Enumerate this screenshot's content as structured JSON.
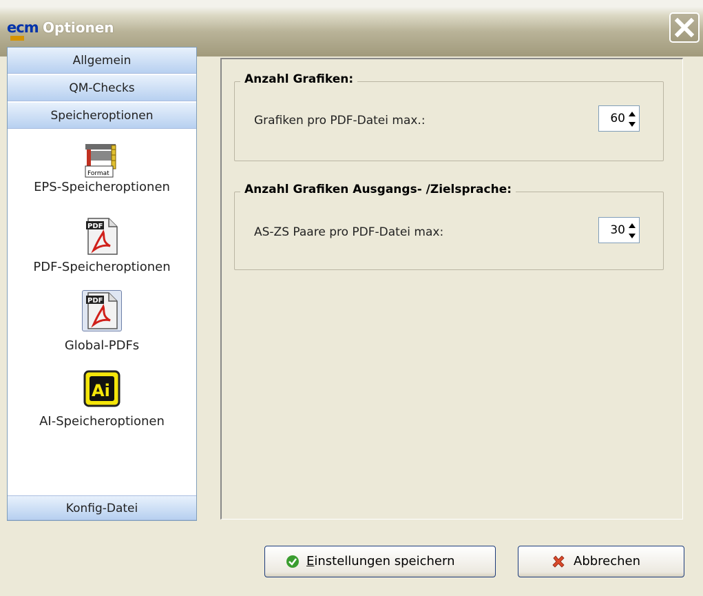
{
  "window": {
    "title": "Optionen",
    "logo_text": "ecm"
  },
  "sidebar": {
    "headers_top": [
      {
        "label": "Allgemein"
      },
      {
        "label": "QM-Checks"
      },
      {
        "label": "Speicheroptionen"
      }
    ],
    "items": [
      {
        "label": "EPS-Speicheroptionen",
        "icon": "format-icon",
        "icon_text": "Format"
      },
      {
        "label": "PDF-Speicheroptionen",
        "icon": "pdf-icon",
        "icon_text": "PDF"
      },
      {
        "label": "Global-PDFs",
        "icon": "pdf-icon",
        "icon_text": "PDF"
      },
      {
        "label": "AI-Speicheroptionen",
        "icon": "ai-icon",
        "icon_text": "Ai"
      }
    ],
    "footer": {
      "label": "Konfig-Datei"
    }
  },
  "main": {
    "groups": [
      {
        "title": "Anzahl Grafiken:",
        "field_label": "Grafiken pro PDF-Datei max.:",
        "value": "60"
      },
      {
        "title": "Anzahl Grafiken Ausgangs- /Zielsprache:",
        "field_label": "AS-ZS Paare pro PDF-Datei max:",
        "value": "30"
      }
    ]
  },
  "buttons": {
    "save": {
      "mnemonic": "E",
      "rest": "instellungen speichern"
    },
    "cancel": {
      "label": "Abbrechen"
    }
  },
  "colors": {
    "accent_blue": "#b7d0f0",
    "window_bg": "#ece9d8",
    "title_bg": "#a29b7d",
    "close_red": "#d94a2b",
    "ok_green": "#3a9d2f"
  }
}
